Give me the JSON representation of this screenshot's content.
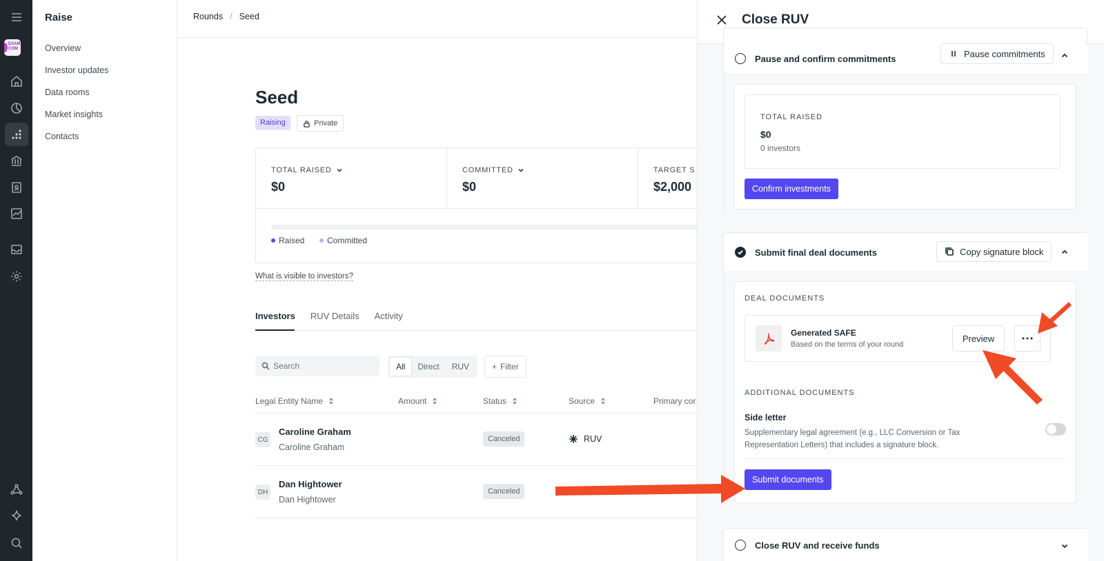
{
  "app": {
    "title": "Raise"
  },
  "nav": {
    "items": [
      {
        "label": "Overview"
      },
      {
        "label": "Investor updates"
      },
      {
        "label": "Data rooms"
      },
      {
        "label": "Market insights"
      },
      {
        "label": "Contacts"
      }
    ]
  },
  "rail": {
    "logo_text": "EXAM COM",
    "icons": [
      "menu-icon",
      "home-icon",
      "pie-chart-icon",
      "raise-icon",
      "bank-icon",
      "contacts-icon",
      "chart-icon",
      "inbox-icon",
      "settings-icon",
      "network-icon",
      "sparkle-icon",
      "search-icon"
    ]
  },
  "breadcrumb": {
    "items": [
      "Rounds",
      "Seed"
    ],
    "sep": "/"
  },
  "page": {
    "title": "Seed",
    "status_badge": "Raising",
    "visibility_badge": "Private",
    "visible_link": "What is visible to investors?"
  },
  "stats": [
    {
      "label": "TOTAL RAISED",
      "value": "$0"
    },
    {
      "label": "COMMITTED",
      "value": "$0"
    },
    {
      "label": "TARGET S",
      "value": "$2,000"
    }
  ],
  "legend": [
    {
      "label": "Raised",
      "color": "#5447f0"
    },
    {
      "label": "Committed",
      "color": "#b9b3f5"
    }
  ],
  "tabs": [
    "Investors",
    "RUV Details",
    "Activity"
  ],
  "filters": {
    "search_placeholder": "Search",
    "segments": [
      "All",
      "Direct",
      "RUV"
    ],
    "filter_label": "Filter"
  },
  "table": {
    "columns": [
      "Legal Entity Name",
      "Amount",
      "Status",
      "Source",
      "Primary cor"
    ],
    "rows": [
      {
        "initials": "CG",
        "name": "Caroline Graham",
        "entity": "Caroline Graham",
        "status": "Canceled",
        "source": "RUV"
      },
      {
        "initials": "DH",
        "name": "Dan Hightower",
        "entity": "Dan Hightower",
        "status": "Canceled",
        "source": ""
      }
    ]
  },
  "panel": {
    "title": "Close RUV",
    "step1": {
      "title": "Pause and confirm commitments",
      "button": "Pause commitments",
      "total_label": "TOTAL RAISED",
      "total_value": "$0",
      "investors": "0 investors",
      "confirm_button": "Confirm investments"
    },
    "step2": {
      "title": "Submit final deal documents",
      "button": "Copy signature block",
      "deal_docs_label": "DEAL DOCUMENTS",
      "doc_name": "Generated SAFE",
      "doc_desc": "Based on the terms of your round",
      "preview_button": "Preview",
      "additional_label": "ADDITIONAL DOCUMENTS",
      "side_letter_title": "Side letter",
      "side_letter_desc": "Supplementary legal agreement (e.g., LLC Conversion or Tax Representation Letters) that includes a signature block.",
      "side_letter_enabled": false,
      "submit_button": "Submit documents"
    },
    "step3": {
      "title": "Close RUV and receive funds"
    }
  },
  "colors": {
    "accent": "#5447f0",
    "arrow": "#f04a26",
    "rail": "#1f272c"
  }
}
